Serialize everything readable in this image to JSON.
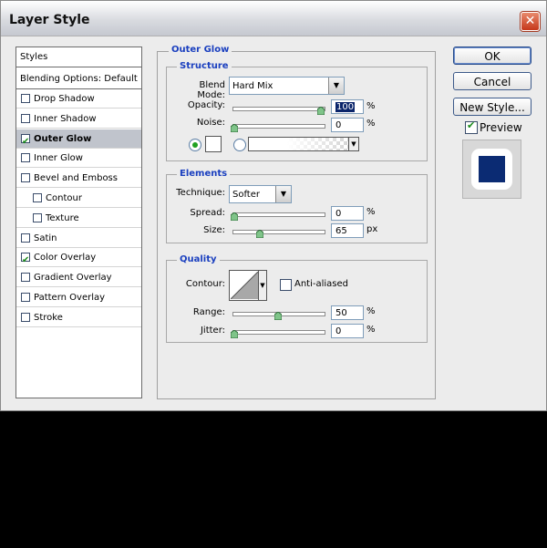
{
  "window": {
    "title": "Layer Style"
  },
  "styles_panel": {
    "header": "Styles",
    "blending": "Blending Options: Default",
    "items": [
      {
        "label": "Drop Shadow",
        "checked": false,
        "indent": 0
      },
      {
        "label": "Inner Shadow",
        "checked": false,
        "indent": 0
      },
      {
        "label": "Outer Glow",
        "checked": true,
        "indent": 0,
        "selected": true
      },
      {
        "label": "Inner Glow",
        "checked": false,
        "indent": 0
      },
      {
        "label": "Bevel and Emboss",
        "checked": false,
        "indent": 0
      },
      {
        "label": "Contour",
        "checked": false,
        "indent": 1
      },
      {
        "label": "Texture",
        "checked": false,
        "indent": 1
      },
      {
        "label": "Satin",
        "checked": false,
        "indent": 0
      },
      {
        "label": "Color Overlay",
        "checked": true,
        "indent": 0
      },
      {
        "label": "Gradient Overlay",
        "checked": false,
        "indent": 0
      },
      {
        "label": "Pattern Overlay",
        "checked": false,
        "indent": 0
      },
      {
        "label": "Stroke",
        "checked": false,
        "indent": 0
      }
    ]
  },
  "outer_glow": {
    "title": "Outer Glow",
    "structure": {
      "title": "Structure",
      "blend_mode_label": "Blend Mode:",
      "blend_mode_value": "Hard Mix",
      "opacity_label": "Opacity:",
      "opacity_value": "100",
      "opacity_unit": "%",
      "noise_label": "Noise:",
      "noise_value": "0",
      "noise_unit": "%"
    },
    "elements": {
      "title": "Elements",
      "technique_label": "Technique:",
      "technique_value": "Softer",
      "spread_label": "Spread:",
      "spread_value": "0",
      "spread_unit": "%",
      "size_label": "Size:",
      "size_value": "65",
      "size_unit": "px"
    },
    "quality": {
      "title": "Quality",
      "contour_label": "Contour:",
      "anti_aliased_label": "Anti-aliased",
      "range_label": "Range:",
      "range_value": "50",
      "range_unit": "%",
      "jitter_label": "Jitter:",
      "jitter_value": "0",
      "jitter_unit": "%"
    }
  },
  "buttons": {
    "ok": "OK",
    "cancel": "Cancel",
    "new_style": "New Style..."
  },
  "preview": {
    "label": "Preview",
    "checked": true,
    "swatch_color": "#0b2b73"
  },
  "colors": {
    "legend": "#1a3fbf",
    "preview_fill": "#0b2b73"
  }
}
